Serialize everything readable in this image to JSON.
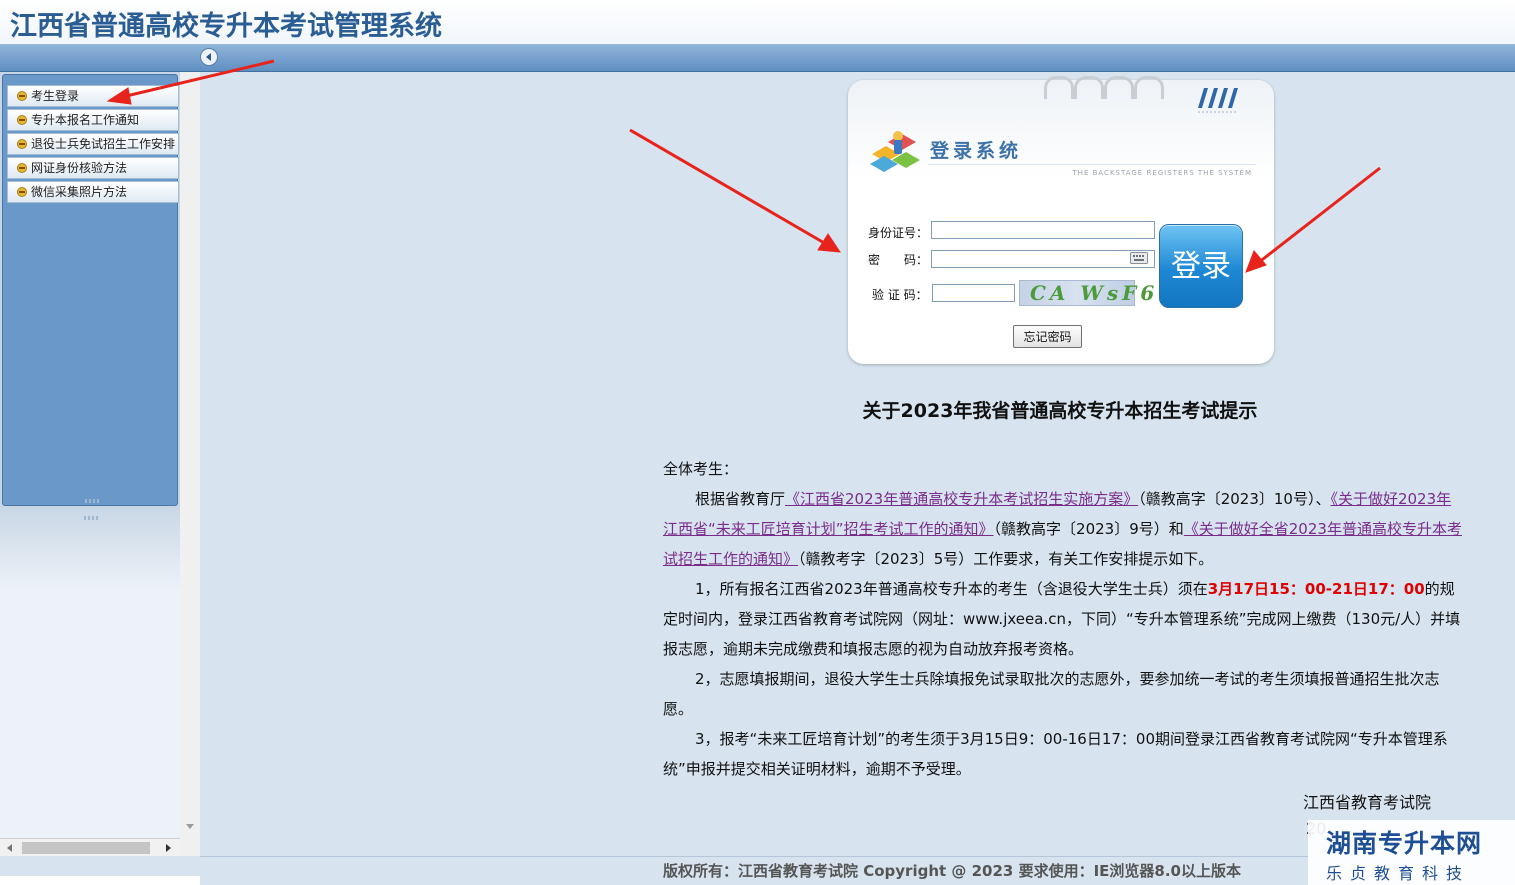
{
  "app": {
    "title": "江西省普通高校专升本考试管理系统"
  },
  "sidebar": {
    "items": [
      {
        "label": "考生登录"
      },
      {
        "label": "专升本报名工作通知"
      },
      {
        "label": "退役士兵免试招生工作安排"
      },
      {
        "label": "网证身份核验方法"
      },
      {
        "label": "微信采集照片方法"
      }
    ]
  },
  "login": {
    "title": "登录系统",
    "subtitle": "THE BACKSTAGE REGISTERS THE SYSTEM",
    "id_label": "身份证号：",
    "id_value": "",
    "password_label": "密　　码：",
    "password_value": "",
    "captcha_label": "验 证 码：",
    "captcha_value": "",
    "captcha_text": "CA WsF6",
    "login_button": "登录",
    "forgot_button": "忘记密码"
  },
  "notice": {
    "title": "关于2023年我省普通高校专升本招生考试提示",
    "greeting": "全体考生：",
    "para1": {
      "t1": "根据省教育厅",
      "link1": "《江西省2023年普通高校专升本考试招生实施方案》",
      "t2": "（赣教高字〔2023〕10号）、",
      "link2": "《关于做好2023年江西省“未来工匠培育计划”招生考试工作的通知》",
      "t3": "（赣教高字〔2023〕9号）和",
      "link3": "《关于做好全省2023年普通高校专升本考试招生工作的通知》",
      "t4": "（赣教考字〔2023〕5号）工作要求，有关工作安排提示如下。"
    },
    "para2": {
      "t1": "1，所有报名江西省2023年普通高校专升本的考生（含退役大学生士兵）须在",
      "highlight": "3月17日15：00-21日17：00",
      "t2": "的规定时间内，登录江西省教育考试院网（网址：www.jxeea.cn，下同）“专升本管理系统”完成网上缴费（130元/人）并填报志愿，逾期未完成缴费和填报志愿的视为自动放弃报考资格。"
    },
    "para3": "2，志愿填报期间，退役大学生士兵除填报免试录取批次的志愿外，要参加统一考试的考生须填报普通招生批次志愿。",
    "para4": "3，报考“未来工匠培育计划”的考生须于3月15日9：00-16日17：00期间登录江西省教育考试院网“专升本管理系统”申报并提交相关证明材料，逾期不予受理。",
    "signature": "江西省教育考试院",
    "date_partial": "20"
  },
  "footer": {
    "text": "版权所有：江西省教育考试院 Copyright @ 2023 要求使用：IE浏览器8.0以上版本"
  },
  "watermark": {
    "main": "湖南专升本网",
    "sub": "乐贞教育科技"
  },
  "colors": {
    "title_blue": "#2a5d93",
    "sidebar_blue": "#6a98c9",
    "link_purple": "#7a2c8a",
    "highlight_red": "#e00000",
    "arrow_red": "#e8231c",
    "login_button_blue": "#1e88d4"
  },
  "icons": [
    "collapse-left-icon",
    "menu-bullet-icon",
    "login-logo-icon",
    "keyboard-icon",
    "scroll-left-icon",
    "scroll-right-icon",
    "scroll-down-icon"
  ]
}
